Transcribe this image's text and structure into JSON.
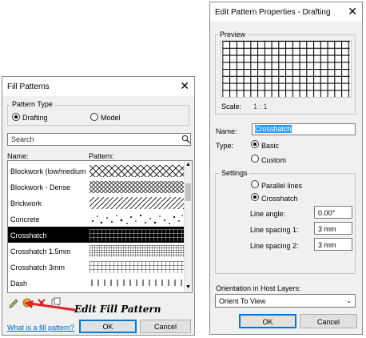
{
  "fill_patterns": {
    "title": "Fill Patterns",
    "pattern_type": {
      "label": "Pattern Type",
      "options": [
        {
          "label": "Drafting",
          "selected": true
        },
        {
          "label": "Model",
          "selected": false
        }
      ]
    },
    "search_placeholder": "Search",
    "columns": {
      "name": "Name:",
      "pattern": "Pattern:"
    },
    "rows": [
      {
        "name": "Blockwork (low/medium",
        "pattern": "crosshatch-diag-sparse"
      },
      {
        "name": "Blockwork - Dense",
        "pattern": "crosshatch-diag-dense"
      },
      {
        "name": "Brickwork",
        "pattern": "diagonal"
      },
      {
        "name": "Concrete",
        "pattern": "stipple"
      },
      {
        "name": "Crosshatch",
        "pattern": "grid",
        "selected": true
      },
      {
        "name": "Crosshatch 1.5mm",
        "pattern": "grid-fine"
      },
      {
        "name": "Crosshatch 3mm",
        "pattern": "grid"
      },
      {
        "name": "Dash",
        "pattern": "dashes"
      }
    ],
    "toolbar_icons": [
      "pencil-icon",
      "new-pattern-icon",
      "delete-icon",
      "duplicate-icon"
    ],
    "annotation": "Edit Fill Pattern",
    "annotation_color": "#e0242a",
    "help_link": "What is a fill pattern?",
    "ok": "OK",
    "cancel": "Cancel"
  },
  "edit_pattern": {
    "title": "Edit Pattern Properties - Drafting",
    "preview": {
      "label": "Preview",
      "scale_label": "Scale:",
      "scale_value": "1 : 1"
    },
    "name_label": "Name:",
    "name_value": "Crosshatch",
    "type": {
      "label": "Type:",
      "options": [
        {
          "label": "Basic",
          "selected": true
        },
        {
          "label": "Custom",
          "selected": false
        }
      ]
    },
    "settings": {
      "label": "Settings",
      "options": [
        {
          "label": "Parallel lines",
          "selected": false
        },
        {
          "label": "Crosshatch",
          "selected": true
        }
      ],
      "fields": [
        {
          "label": "Line angle:",
          "value": "0.00°"
        },
        {
          "label": "Line spacing 1:",
          "value": "3 mm"
        },
        {
          "label": "Line spacing 2:",
          "value": "3 mm"
        }
      ]
    },
    "orientation": {
      "label": "Orientation in Host Layers:",
      "value": "Orient To View"
    },
    "ok": "OK",
    "cancel": "Cancel",
    "selection_color": "#3399ff"
  }
}
